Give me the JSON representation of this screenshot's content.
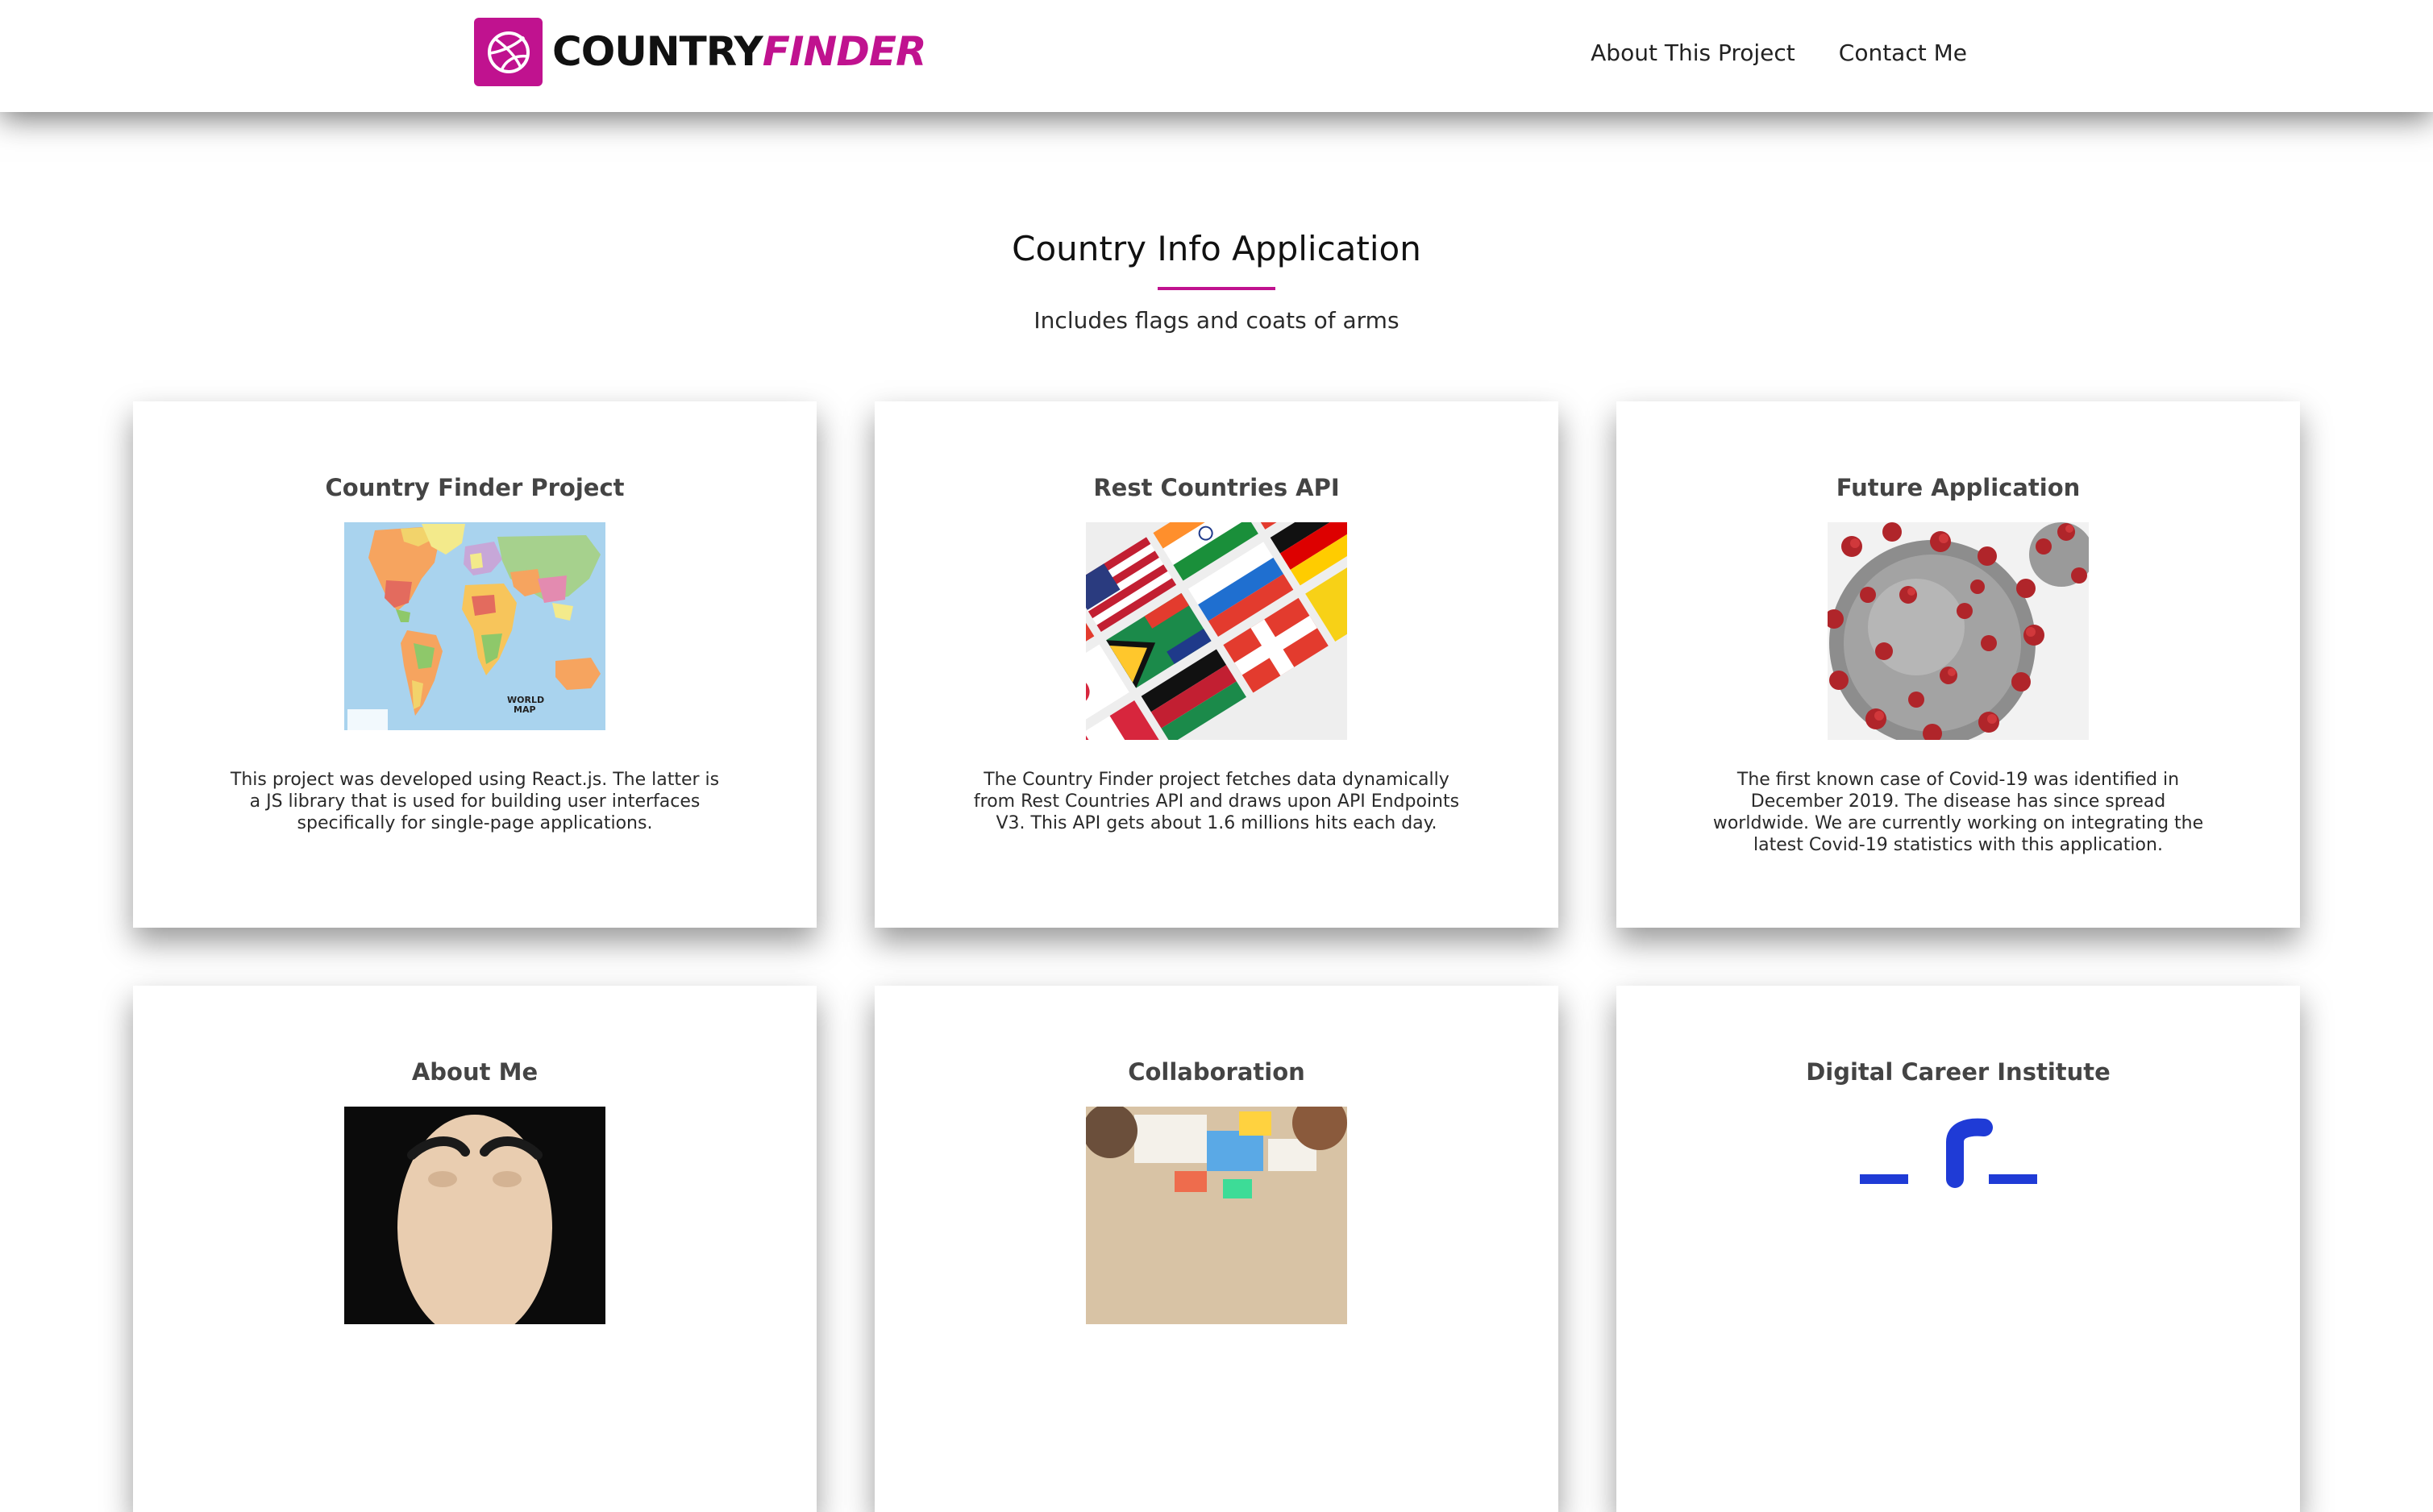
{
  "header": {
    "logo": {
      "word_primary": "COUNTRY",
      "word_accent": "FINDER",
      "icon": "dribbble-ball-icon"
    },
    "nav": [
      {
        "label": "About This Project"
      },
      {
        "label": "Contact Me"
      }
    ]
  },
  "hero": {
    "title": "Country Info Application",
    "subtitle": "Includes flags and coats of arms"
  },
  "cards": [
    {
      "title": "Country Finder Project",
      "image": "world-map-image",
      "text": "This project was developed using React.js. The latter is a JS library that is used for building user interfaces specifically for single-page applications."
    },
    {
      "title": "Rest Countries API",
      "image": "world-flags-image",
      "text": "The Country Finder project fetches data dynamically from Rest Countries API and draws upon API Endpoints V3. This API gets about 1.6 millions hits each day."
    },
    {
      "title": "Future Application",
      "image": "coronavirus-image",
      "text": "The first known case of Covid-19 was identified in December 2019. The disease has since spread worldwide. We are currently working on integrating the latest Covid-19 statistics with this application."
    },
    {
      "title": "About Me",
      "image": "mask-portrait-image",
      "text": ""
    },
    {
      "title": "Collaboration",
      "image": "team-collaboration-image",
      "text": ""
    },
    {
      "title": "Digital Career Institute",
      "image": "dci-logo-image",
      "text": ""
    }
  ],
  "colors": {
    "accent": "#c0128f",
    "text": "#1f1f1f",
    "card_title": "#444444"
  }
}
